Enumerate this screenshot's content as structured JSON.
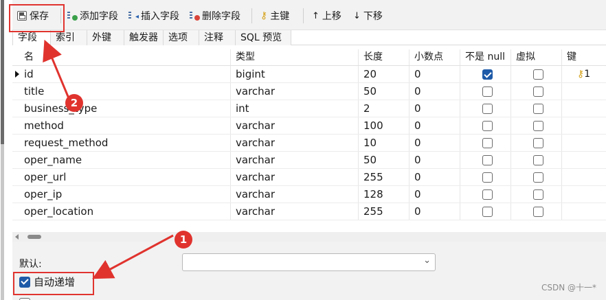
{
  "toolbar": {
    "save": "保存",
    "add_field": "添加字段",
    "insert_field": "插入字段",
    "delete_field": "删除字段",
    "primary_key": "主键",
    "move_up": "上移",
    "move_down": "下移",
    "icons": {
      "save": "save-icon",
      "add": "add-field-icon",
      "insert": "insert-field-icon",
      "delete": "delete-field-icon",
      "key": "key-icon",
      "up": "arrow-up-icon",
      "down": "arrow-down-icon"
    }
  },
  "tabs": [
    "字段",
    "索引",
    "外键",
    "触发器",
    "选项",
    "注释",
    "SQL 预览"
  ],
  "active_tab": "字段",
  "columns": {
    "name": "名",
    "type": "类型",
    "length": "长度",
    "decimals": "小数点",
    "not_null": "不是 null",
    "virtual": "虚拟",
    "key": "键"
  },
  "rows": [
    {
      "name": "id",
      "type": "bigint",
      "length": "20",
      "decimals": "0",
      "not_null": true,
      "virtual": false,
      "key": "1"
    },
    {
      "name": "title",
      "type": "varchar",
      "length": "50",
      "decimals": "0",
      "not_null": false,
      "virtual": false,
      "key": ""
    },
    {
      "name": "business_type",
      "type": "int",
      "length": "2",
      "decimals": "0",
      "not_null": false,
      "virtual": false,
      "key": ""
    },
    {
      "name": "method",
      "type": "varchar",
      "length": "100",
      "decimals": "0",
      "not_null": false,
      "virtual": false,
      "key": ""
    },
    {
      "name": "request_method",
      "type": "varchar",
      "length": "10",
      "decimals": "0",
      "not_null": false,
      "virtual": false,
      "key": ""
    },
    {
      "name": "oper_name",
      "type": "varchar",
      "length": "50",
      "decimals": "0",
      "not_null": false,
      "virtual": false,
      "key": ""
    },
    {
      "name": "oper_url",
      "type": "varchar",
      "length": "255",
      "decimals": "0",
      "not_null": false,
      "virtual": false,
      "key": ""
    },
    {
      "name": "oper_ip",
      "type": "varchar",
      "length": "128",
      "decimals": "0",
      "not_null": false,
      "virtual": false,
      "key": ""
    },
    {
      "name": "oper_location",
      "type": "varchar",
      "length": "255",
      "decimals": "0",
      "not_null": false,
      "virtual": false,
      "key": ""
    }
  ],
  "props": {
    "default_label": "默认:",
    "default_value": "",
    "auto_increment_label": "自动递增",
    "auto_increment_checked": true
  },
  "annotations": {
    "badge1": "1",
    "badge2": "2",
    "color": "#e0332e"
  },
  "watermark": "CSDN @十一*"
}
